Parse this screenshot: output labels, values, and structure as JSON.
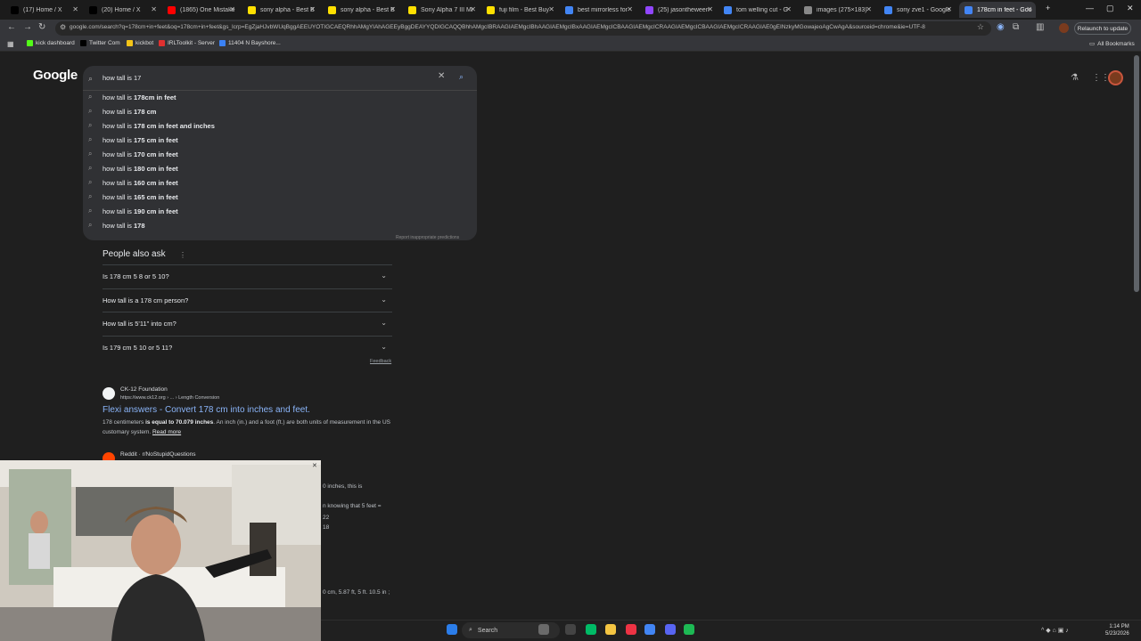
{
  "tabs": [
    {
      "title": "(17) Home / X",
      "favicon": "x-logo-icon",
      "color": "#000000"
    },
    {
      "title": "(20) Home / X",
      "favicon": "x-logo-icon",
      "color": "#000000"
    },
    {
      "title": "(1865) One Mistake",
      "favicon": "youtube-icon",
      "color": "#ff0000"
    },
    {
      "title": "sony alpha - Best B",
      "favicon": "bestbuy-icon",
      "color": "#ffe000"
    },
    {
      "title": "sony alpha - Best B",
      "favicon": "bestbuy-icon",
      "color": "#ffe000"
    },
    {
      "title": "Sony Alpha 7 III Mi",
      "favicon": "bestbuy-icon",
      "color": "#ffe000"
    },
    {
      "title": "fuji film - Best Buy",
      "favicon": "bestbuy-icon",
      "color": "#ffe000"
    },
    {
      "title": "best mirrorless for",
      "favicon": "google-icon",
      "color": "#4285f4"
    },
    {
      "title": "(25) jasontheween",
      "favicon": "twitch-icon",
      "color": "#9146ff"
    },
    {
      "title": "tom welling cut - G",
      "favicon": "google-icon",
      "color": "#4285f4"
    },
    {
      "title": "images (275×183)",
      "favicon": "image-icon",
      "color": "#888888"
    },
    {
      "title": "sony zve1 - Google",
      "favicon": "google-icon",
      "color": "#4285f4"
    },
    {
      "title": "178cm in feet - Goo",
      "favicon": "google-icon",
      "color": "#4285f4",
      "active": true
    }
  ],
  "address_bar": {
    "url": "google.com/search?q=178cm+in+feet&oq=178cm+in+feet&gs_lcrp=EgZjaHJvbWUqBggAEEUYOTIGCAEQRhhAMgYIAhAGEEyBggDEAYYQDIGCAQQBhhAMgcIBRAAGIAEMgcIBhAAGIAEMgcIBxAAGIAEMgcICBAAGIAEMgcICRAAGIAEMgcICBAAGIAEMgcICRAAGIAE0gEINzkyMGowajeoAgCwAgA&sourceid=chrome&ie=UTF-8",
    "relaunch_label": "Relaunch to update"
  },
  "bookmarks": [
    {
      "label": "kick dashboard",
      "color": "#53fc18"
    },
    {
      "label": "Twitter Com",
      "color": "#000000"
    },
    {
      "label": "kickbot",
      "color": "#f5c518"
    },
    {
      "label": "IRLToolkit - Server",
      "color": "#e03030"
    },
    {
      "label": "11404 N Bayshore...",
      "color": "#3b82f6"
    }
  ],
  "all_bookmarks_label": "All Bookmarks",
  "google": {
    "logo": "Google",
    "query": "how tall is 17",
    "suggestions": [
      {
        "prefix": "how tall is ",
        "bold": "178cm in feet"
      },
      {
        "prefix": "how tall is ",
        "bold": "178 cm"
      },
      {
        "prefix": "how tall is ",
        "bold": "178 cm in feet and inches"
      },
      {
        "prefix": "how tall is ",
        "bold": "175 cm in feet"
      },
      {
        "prefix": "how tall is ",
        "bold": "170 cm in feet"
      },
      {
        "prefix": "how tall is ",
        "bold": "180 cm in feet"
      },
      {
        "prefix": "how tall is ",
        "bold": "160 cm in feet"
      },
      {
        "prefix": "how tall is ",
        "bold": "165 cm in feet"
      },
      {
        "prefix": "how tall is ",
        "bold": "190 cm in feet"
      },
      {
        "prefix": "how tall is ",
        "bold": "178"
      }
    ],
    "report_label": "Report inappropriate predictions"
  },
  "paa": {
    "title": "People also ask",
    "questions": [
      "Is 178 cm 5 8 or 5 10?",
      "How tall is a 178 cm person?",
      "How tall is 5'11\" into cm?",
      "Is 179 cm 5 10 or 5 11?"
    ],
    "feedback": "Feedback"
  },
  "result": {
    "site": "CK-12 Foundation",
    "url": "https://www.ck12.org › ... › Length Conversion",
    "title": "Flexi answers - Convert 178 cm into inches and feet.",
    "snippet_a": "178 centimeters ",
    "snippet_b": "is equal to 70.079 inches",
    "snippet_c": ". An inch (in.) and a foot (ft.) are both units of measurement in the US customary system. ",
    "read_more": "Read more"
  },
  "reddit": {
    "site": "Reddit · r/NoStupidQuestions",
    "frag1": "0 inches, this is",
    "frag2": "n knowing that 5 feet =",
    "frag3": "22",
    "frag4": "18",
    "frag5": "0 cm, 5.87 ft, 5 ft. 10.5 in ;"
  },
  "taskbar": {
    "search_label": "Search",
    "time": "1:14 PM",
    "date": "5/23/2026"
  }
}
